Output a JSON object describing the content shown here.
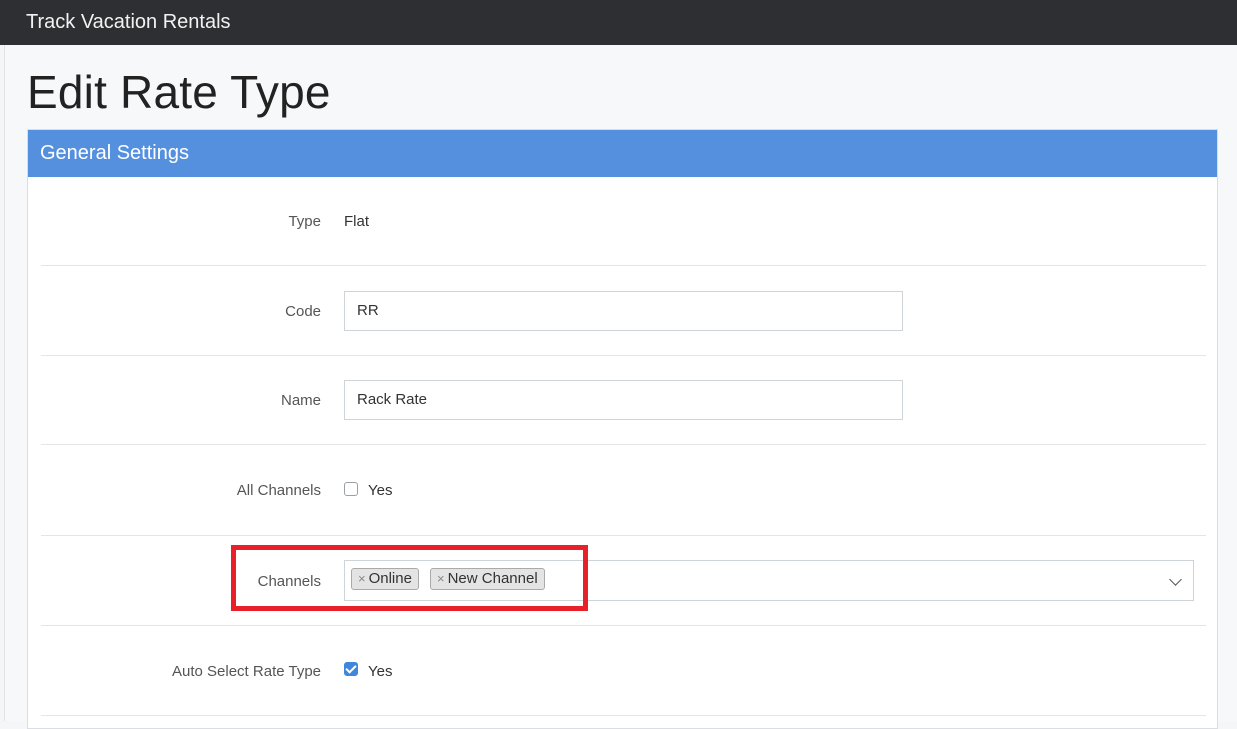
{
  "app": {
    "title": "Track Vacation Rentals"
  },
  "page": {
    "title": "Edit Rate Type"
  },
  "panel": {
    "header": "General Settings"
  },
  "fields": {
    "type": {
      "label": "Type",
      "value": "Flat"
    },
    "code": {
      "label": "Code",
      "value": "RR"
    },
    "name": {
      "label": "Name",
      "value": "Rack Rate"
    },
    "all_channels": {
      "label": "All Channels",
      "option_label": "Yes",
      "checked": false
    },
    "channels": {
      "label": "Channels",
      "selected": [
        {
          "remove": "×",
          "label": "Online"
        },
        {
          "remove": "×",
          "label": "New Channel"
        }
      ]
    },
    "auto_select": {
      "label": "Auto Select Rate Type",
      "option_label": "Yes",
      "checked": true
    }
  },
  "colors": {
    "topbar": "#2d2f33",
    "panel_header": "#5590df",
    "checkbox_checked": "#3f87dd",
    "highlight": "#e8202a"
  }
}
